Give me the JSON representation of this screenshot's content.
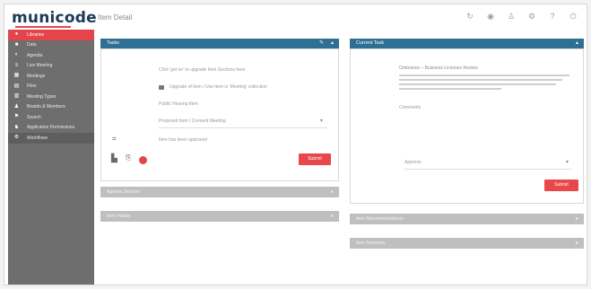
{
  "header": {
    "logo": "municode",
    "breadcrumb": "Item Detail",
    "icons": [
      "refresh-icon",
      "globe-icon",
      "user-icon",
      "settings-icon",
      "help-icon",
      "logout-icon"
    ]
  },
  "sidebar": {
    "items": [
      {
        "label": "Libraries",
        "icon": "circle-icon",
        "active": true
      },
      {
        "label": "Data",
        "icon": "home-icon"
      },
      {
        "label": "Agenda",
        "icon": "gauge-icon"
      },
      {
        "label": "Live Meeting",
        "icon": "list-icon"
      },
      {
        "label": "Meetings",
        "icon": "grid-icon"
      },
      {
        "label": "Files",
        "icon": "file-icon"
      },
      {
        "label": "Meeting Types",
        "icon": "doc-icon"
      },
      {
        "label": "Boards & Members",
        "icon": "people-icon"
      },
      {
        "label": "Search",
        "icon": "flag-icon"
      },
      {
        "label": "Application Permissions",
        "icon": "users-icon"
      },
      {
        "label": "Workflows",
        "icon": "gear-icon",
        "dark": true
      }
    ]
  },
  "left_panel": {
    "title": "Tasks",
    "rows": {
      "prompt": "Click 'get on' to upgrade Item Sections here",
      "folder_line": "Upgrade of Item / Use Item in 'Meeting' collection",
      "plain_line": "Public Hearing Item",
      "select_value": "Proposed Item / Consent Meeting",
      "sub_line": "Item has been approved"
    },
    "submit_label": "Submit"
  },
  "left_collapsed": [
    {
      "label": "Agenda Sections"
    },
    {
      "label": "Item History"
    }
  ],
  "right_panel": {
    "title": "Current Task",
    "task_title": "Ordinance – Business Licenses Review",
    "task_label": "Comments",
    "select_value": "Approve",
    "submit_label": "Submit"
  },
  "right_collapsed": [
    {
      "label": "Item Recommendations"
    },
    {
      "label": "Item Summary"
    }
  ]
}
